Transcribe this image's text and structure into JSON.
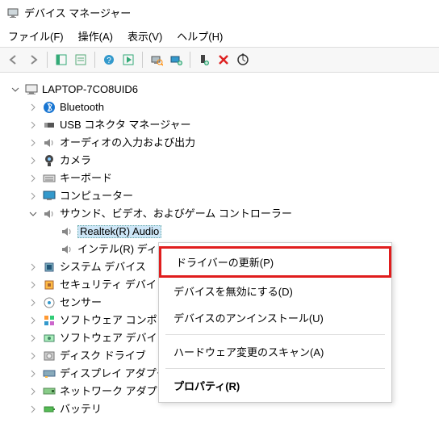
{
  "title": "デバイス マネージャー",
  "menu": {
    "file": "ファイル(F)",
    "action": "操作(A)",
    "view": "表示(V)",
    "help": "ヘルプ(H)"
  },
  "tree": {
    "root": "LAPTOP-7CO8UID6",
    "bluetooth": "Bluetooth",
    "usb": "USB コネクタ マネージャー",
    "audio_io": "オーディオの入力および出力",
    "camera": "カメラ",
    "keyboard": "キーボード",
    "computer": "コンピューター",
    "sound_video_game": "サウンド、ビデオ、およびゲーム コントローラー",
    "realtek": "Realtek(R) Audio",
    "intel": "インテル(R) ディ",
    "system_devices": "システム デバイス",
    "security_devices": "セキュリティ デバイ",
    "sensor": "センサー",
    "software_components": "ソフトウェア コンポ",
    "software_devices": "ソフトウェア デバイ",
    "disk_drives": "ディスク ドライブ",
    "display_adapters": "ディスプレイ アダプター",
    "network_adapters": "ネットワーク アダプター",
    "battery": "バッテリ"
  },
  "context_menu": {
    "update_driver": "ドライバーの更新(P)",
    "disable_device": "デバイスを無効にする(D)",
    "uninstall_device": "デバイスのアンインストール(U)",
    "scan_hardware": "ハードウェア変更のスキャン(A)",
    "properties": "プロパティ(R)"
  }
}
